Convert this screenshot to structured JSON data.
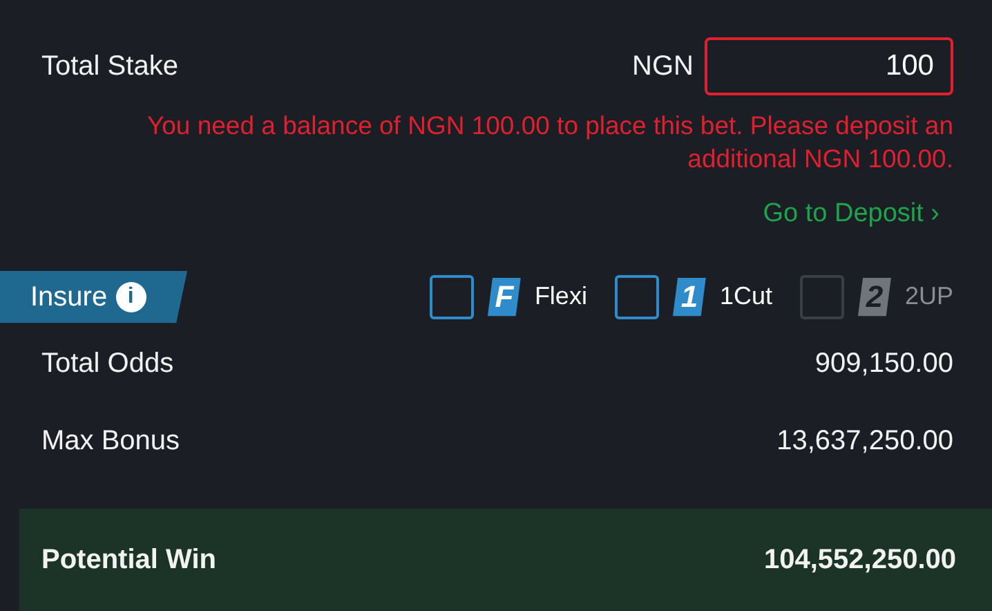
{
  "stake": {
    "label": "Total Stake",
    "currency": "NGN",
    "value": "100",
    "invalid": true
  },
  "error": "You need a balance of NGN 100.00 to place this bet. Please deposit an additional NGN 100.00.",
  "deposit_link": {
    "label": "Go to Deposit",
    "chevron": "›"
  },
  "insure": {
    "label": "Insure",
    "info": "i"
  },
  "options": [
    {
      "badge": "F",
      "label": "Flexi",
      "checked": false,
      "disabled": false
    },
    {
      "badge": "1",
      "label": "1Cut",
      "checked": false,
      "disabled": false
    },
    {
      "badge": "2",
      "label": "2UP",
      "checked": false,
      "disabled": true
    }
  ],
  "summary": [
    {
      "label": "Total Odds",
      "value": "909,150.00",
      "highlight": false
    },
    {
      "label": "Max Bonus",
      "value": "13,637,250.00",
      "highlight": false
    },
    {
      "label": "Potential Win",
      "value": "104,552,250.00",
      "highlight": true
    }
  ]
}
